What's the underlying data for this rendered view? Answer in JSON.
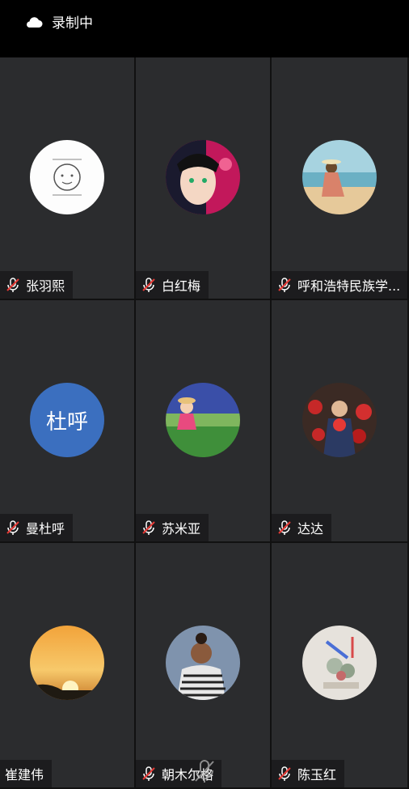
{
  "status": {
    "recording_label": "录制中"
  },
  "participants": [
    {
      "name": "张羽熙",
      "initials": ""
    },
    {
      "name": "白红梅",
      "initials": ""
    },
    {
      "name": "呼和浩特民族学...",
      "initials": ""
    },
    {
      "name": "曼杜呼",
      "initials": "杜呼"
    },
    {
      "name": "苏米亚",
      "initials": ""
    },
    {
      "name": "达达",
      "initials": ""
    },
    {
      "name": "崔建伟",
      "initials": ""
    },
    {
      "name": "朝木尔格",
      "initials": ""
    },
    {
      "name": "陈玉红",
      "initials": ""
    }
  ]
}
